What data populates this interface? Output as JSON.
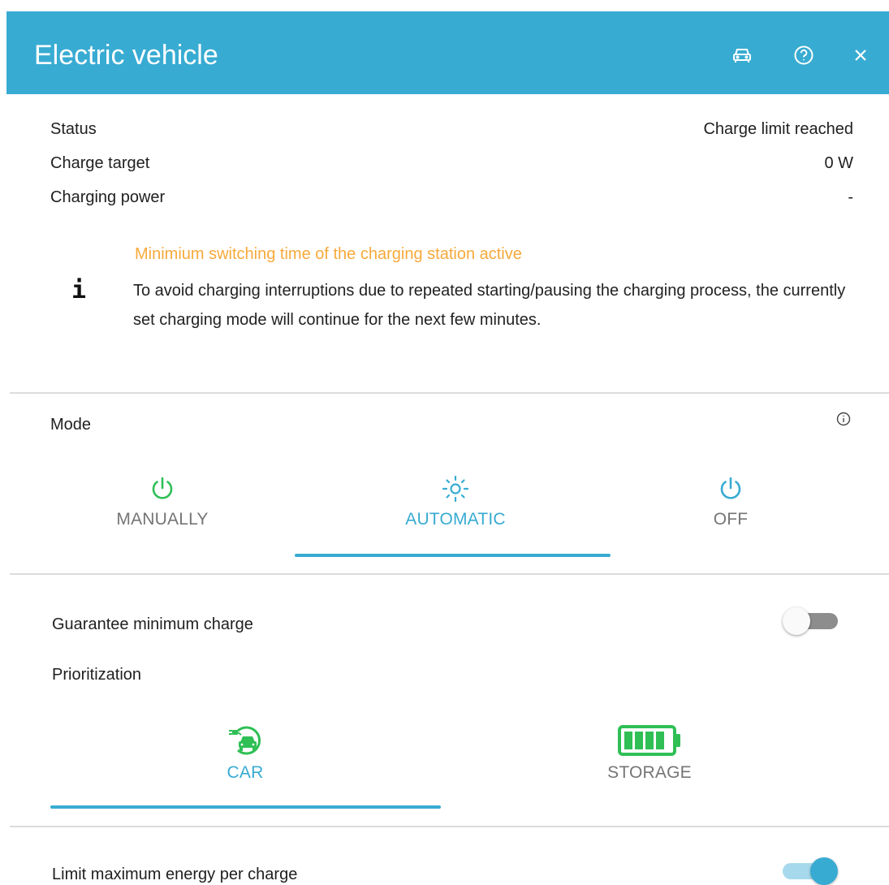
{
  "header": {
    "title": "Electric vehicle",
    "car_icon": "car-icon",
    "help_icon": "help-circle-icon",
    "close_icon": "close-icon"
  },
  "status_rows": [
    {
      "label": "Status",
      "value": "Charge limit reached"
    },
    {
      "label": "Charge target",
      "value": "0 W"
    },
    {
      "label": "Charging power",
      "value": "-"
    }
  ],
  "notice": {
    "icon": "info-icon",
    "title": "Minimium switching time of the charging station active",
    "text": "To avoid charging interruptions due to repeated starting/pausing the charging process, the currently set charging mode will continue for the next few minutes."
  },
  "mode": {
    "label": "Mode",
    "info_icon": "info-circle-icon",
    "tabs": [
      {
        "label": "MANUALLY",
        "icon": "power-icon",
        "icon_color": "#2fbf55",
        "selected": false
      },
      {
        "label": "AUTOMATIC",
        "icon": "sun-icon",
        "icon_color": "#38abd2",
        "selected": true
      },
      {
        "label": "OFF",
        "icon": "power-icon",
        "icon_color": "#38abd2",
        "selected": false
      }
    ]
  },
  "guarantee": {
    "label": "Guarantee minimum charge",
    "enabled": false
  },
  "prioritization": {
    "label": "Prioritization",
    "tabs": [
      {
        "label": "CAR",
        "icon": "car-charging-icon",
        "selected": true
      },
      {
        "label": "STORAGE",
        "icon": "battery-icon",
        "selected": false
      }
    ]
  },
  "limit": {
    "label": "Limit maximum energy per charge",
    "enabled": true
  },
  "colors": {
    "accent": "#38abd2",
    "green": "#2fbf55",
    "warning": "#f7a93b",
    "muted": "#757575"
  }
}
